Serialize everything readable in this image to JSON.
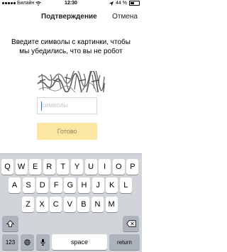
{
  "status_bar": {
    "carrier": "Билайн",
    "time": "12:30",
    "battery_text": "44 %",
    "battery_level": 0.44
  },
  "navbar": {
    "title": "Подтверждение",
    "cancel_label": "Отмена"
  },
  "message": "Введите символы с картинки, чтобы мы убедились, что вы не робот",
  "captcha": {
    "icon": "captcha-image"
  },
  "input": {
    "placeholder": "символы",
    "value": ""
  },
  "submit_label": "Готово",
  "keyboard": {
    "row1": [
      "Q",
      "W",
      "E",
      "R",
      "T",
      "Y",
      "U",
      "I",
      "O",
      "P"
    ],
    "row2": [
      "A",
      "S",
      "D",
      "F",
      "G",
      "H",
      "J",
      "K",
      "L"
    ],
    "row3": [
      "Z",
      "X",
      "C",
      "V",
      "B",
      "N",
      "M"
    ],
    "numbers_label": "123",
    "space_label": "space",
    "return_label": "return",
    "shift_icon": "shift-icon",
    "delete_icon": "delete-icon",
    "globe_icon": "globe-icon",
    "mic_icon": "microphone-icon"
  },
  "colors": {
    "button_bg": "#fbe7a1",
    "caret": "#2b6ff0",
    "keyboard_bg": "#d1d4d9"
  }
}
